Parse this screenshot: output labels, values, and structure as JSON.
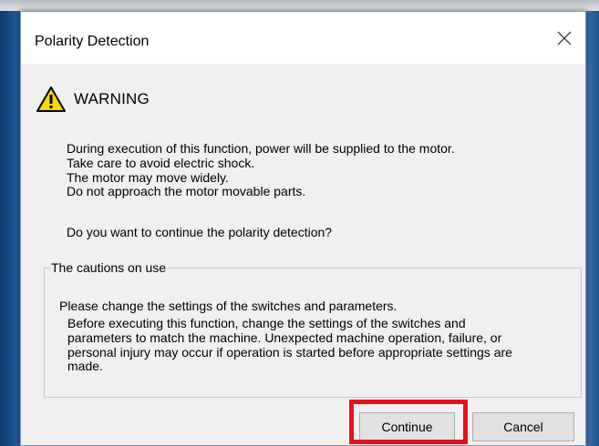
{
  "window": {
    "title": "Polarity Detection"
  },
  "warning": {
    "icon": "warning-triangle-icon",
    "icon_color": "#ffd800",
    "title": "WARNING",
    "lines": [
      "During execution of this function, power will be supplied to the motor.",
      "Take care to avoid electric shock.",
      "The motor may move widely.",
      "Do not approach the motor movable parts."
    ],
    "question": "Do you want to continue the polarity detection?"
  },
  "cautions": {
    "legend": "The cautions on use",
    "heading": "Please change the settings of the switches and parameters.",
    "body_lines": [
      "Before executing this function, change the settings of the switches and",
      "parameters to match the machine. Unexpected machine operation, failure, or",
      "personal injury may occur if operation is started before appropriate settings are",
      "made."
    ]
  },
  "buttons": {
    "continue_label": "Continue",
    "cancel_label": "Cancel"
  },
  "colors": {
    "highlight": "#e8101a",
    "desktop": "#1c4f86"
  }
}
